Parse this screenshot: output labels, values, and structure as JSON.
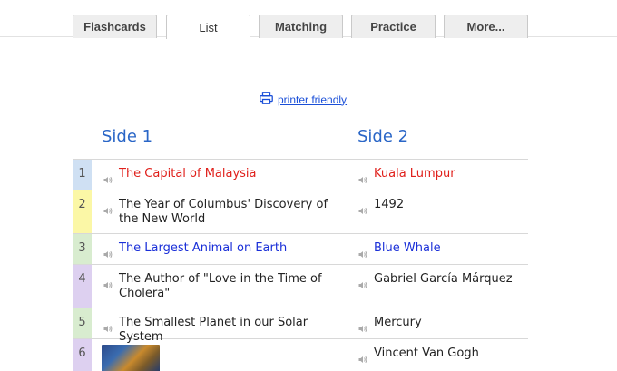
{
  "tabs": [
    {
      "label": "Flashcards",
      "active": false
    },
    {
      "label": "List",
      "active": true
    },
    {
      "label": "Matching",
      "active": false
    },
    {
      "label": "Practice",
      "active": false
    },
    {
      "label": "More...",
      "active": false
    }
  ],
  "printer": {
    "label": "printer friendly",
    "icon": "printer-icon"
  },
  "columns": {
    "side1": "Side 1",
    "side2": "Side 2"
  },
  "colors": {
    "accent_blue": "#2a66c7",
    "red_text": "#e0201b",
    "blue_text": "#1a2fd8",
    "row1": "#cfe0f3",
    "row2": "#fbf7a6",
    "row3": "#d8eccf",
    "row4": "#ddd0f0",
    "row5": "#d8eccf",
    "row6": "#ddd0f0"
  },
  "rows": [
    {
      "num": "1",
      "side1": "The Capital of Malaysia",
      "side2": "Kuala Lumpur"
    },
    {
      "num": "2",
      "side1": "The Year of Columbus' Discovery of the New World",
      "side2": "1492"
    },
    {
      "num": "3",
      "side1": "The Largest Animal on Earth",
      "side2": "Blue Whale"
    },
    {
      "num": "4",
      "side1": "The Author of \"Love in the Time of Cholera\"",
      "side2": "Gabriel García Márquez"
    },
    {
      "num": "5",
      "side1": "The Smallest Planet in our Solar System",
      "side2": "Mercury"
    },
    {
      "num": "6",
      "side1": "",
      "side2": "Vincent Van Gogh"
    }
  ]
}
